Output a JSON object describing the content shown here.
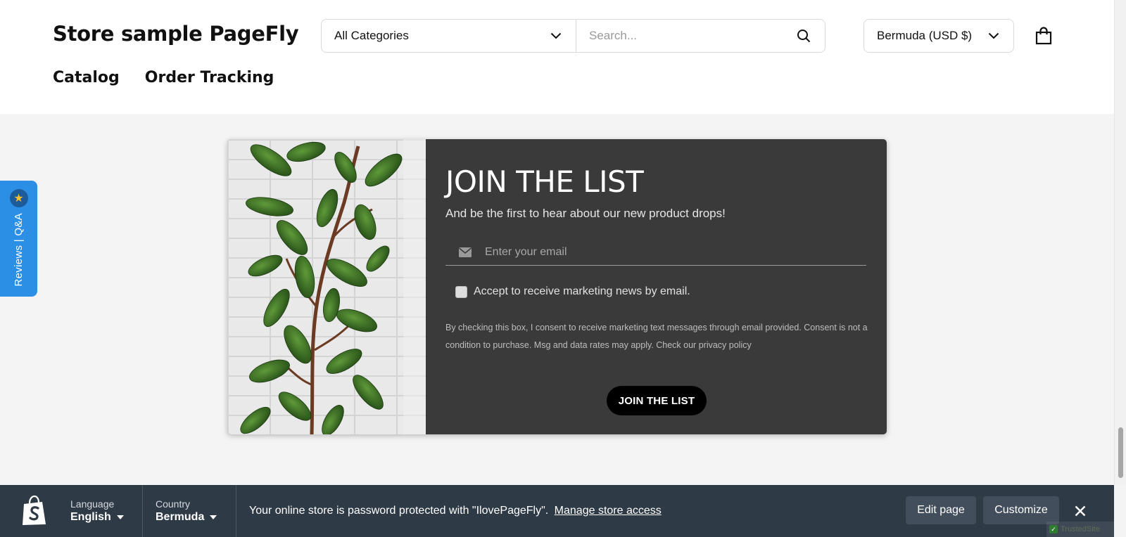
{
  "header": {
    "store_name": "Store sample PageFly",
    "category_select": "All Categories",
    "search_placeholder": "Search...",
    "country_currency": "Bermuda (USD $)",
    "nav": [
      "Catalog",
      "Order Tracking"
    ]
  },
  "reviews_tab": {
    "label": "Reviews | Q&A",
    "icon": "star-icon"
  },
  "newsletter": {
    "title": "JOIN THE LIST",
    "subtitle": "And be the first to hear about our new product drops!",
    "email_placeholder": "Enter your email",
    "consent_label": "Accept to receive marketing news by email.",
    "legal_text": "By checking this box, I consent to receive marketing text messages through email provided. Consent is not a condition to purchase. Msg and data rates may apply. Check our",
    "privacy_link": "privacy policy",
    "button": "JOIN THE LIST"
  },
  "preview_bar": {
    "language_label": "Language",
    "language_value": "English",
    "country_label": "Country",
    "country_value": "Bermuda",
    "message": "Your online store is password protected with \"IlovePageFly\".",
    "manage_link": "Manage store access",
    "edit_button": "Edit page",
    "customize_button": "Customize"
  },
  "trusted_badge": "TrustedSite",
  "colors": {
    "card_background": "#3a3a3a",
    "preview_bar": "#2f3a47",
    "reviews_tab": "#2c8fe6",
    "button": "#000000"
  }
}
